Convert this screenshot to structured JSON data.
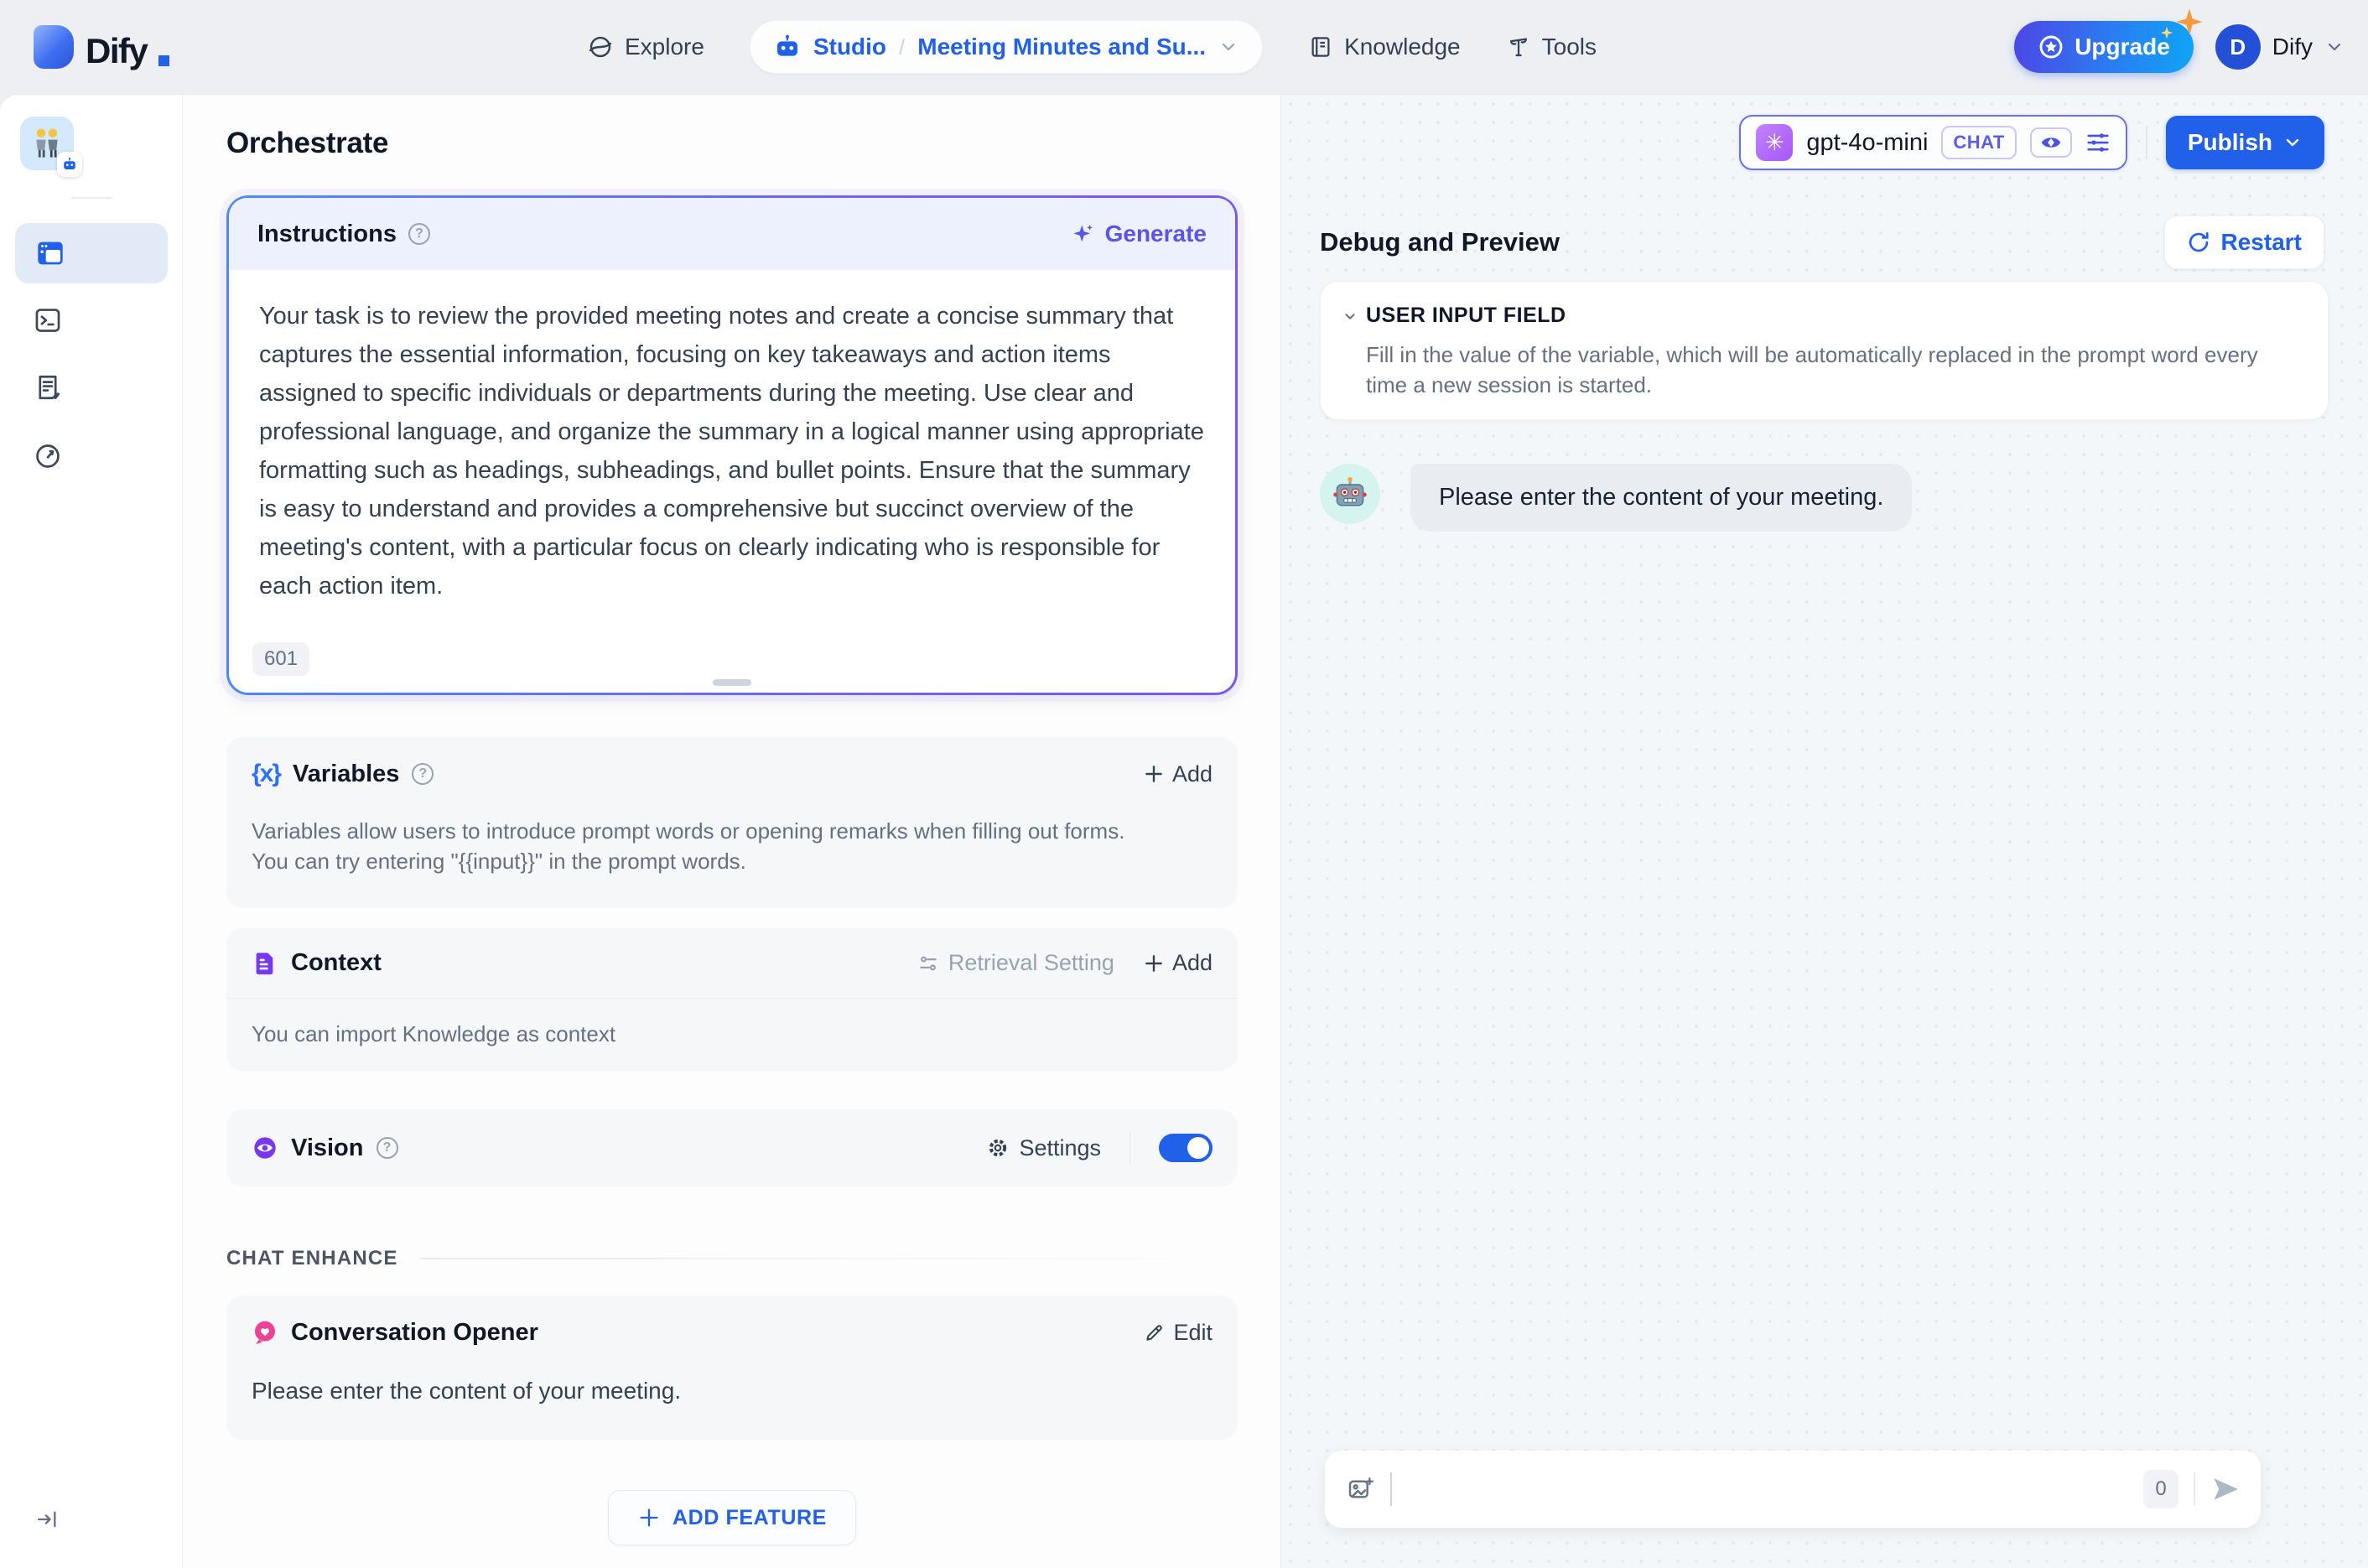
{
  "header": {
    "logo_text": "Dify",
    "nav": [
      {
        "label": "Explore"
      },
      {
        "label": "Knowledge"
      },
      {
        "label": "Tools"
      }
    ],
    "breadcrumb": {
      "studio": "Studio",
      "separator": "/",
      "app_name": "Meeting Minutes and Su..."
    },
    "upgrade_label": "Upgrade",
    "account": {
      "initial": "D",
      "name": "Dify"
    }
  },
  "page": {
    "title": "Orchestrate"
  },
  "model_bar": {
    "model_name": "gpt-4o-mini",
    "mode_badge": "CHAT",
    "openai_glyph": "✳",
    "publish_label": "Publish"
  },
  "instructions": {
    "title": "Instructions",
    "generate_label": "Generate",
    "text": "Your task is to review the provided meeting notes and create a concise summary that captures the essential information, focusing on key takeaways and action items assigned to specific individuals or departments during the meeting. Use clear and professional language, and organize the summary in a logical manner using appropriate formatting such as headings, subheadings, and bullet points. Ensure that the summary is easy to understand and provides a comprehensive but succinct overview of the meeting's content, with a particular focus on clearly indicating who is responsible for each action item.",
    "char_count": "601"
  },
  "variables": {
    "title": "Variables",
    "icon_glyph": "{x}",
    "add_label": "Add",
    "description": "Variables allow users to introduce prompt words or opening remarks when filling out forms. You can try entering \"{{input}}\" in the prompt words."
  },
  "context": {
    "title": "Context",
    "retrieval_setting_label": "Retrieval Setting",
    "add_label": "Add",
    "description": "You can import Knowledge as context"
  },
  "vision": {
    "title": "Vision",
    "settings_label": "Settings",
    "toggle_on": true
  },
  "chat_enhance": {
    "section_label": "CHAT ENHANCE",
    "opener_title": "Conversation Opener",
    "edit_label": "Edit",
    "opener_message": "Please enter the content of your meeting.",
    "add_feature_label": "ADD FEATURE"
  },
  "debug": {
    "title": "Debug and Preview",
    "restart_label": "Restart",
    "user_input_field": {
      "title": "USER INPUT FIELD",
      "description": "Fill in the value of the variable, which will be automatically replaced in the prompt word every time a new session is started."
    },
    "bot_message": "Please enter the content of your meeting.",
    "input": {
      "count": "0"
    }
  },
  "colors": {
    "accent_blue": "#2160e8",
    "indigo": "#5a54e8",
    "purple": "#7839ee",
    "pink": "#ed4295",
    "upgrade_gradient": [
      "#4c47e6",
      "#0ea5f6"
    ]
  }
}
